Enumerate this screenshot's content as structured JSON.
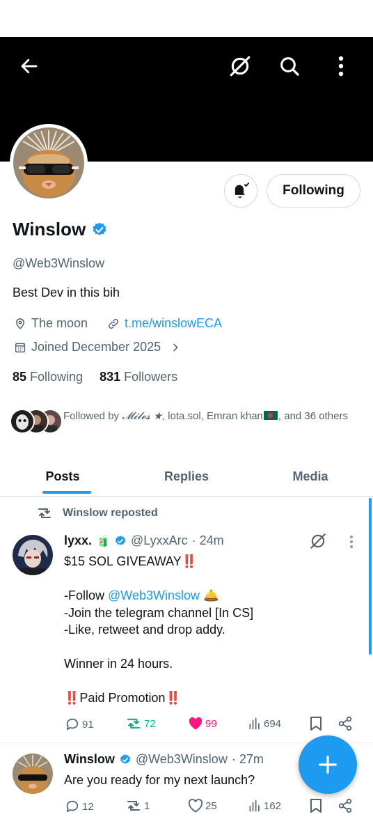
{
  "profile": {
    "name": "Winslow",
    "handle": "@Web3Winslow",
    "bio": "Best Dev in this bih",
    "location": "The moon",
    "website": "t.me/winslowECA",
    "joined": "Joined December 2025",
    "following_count": "85",
    "following_label": "Following",
    "followers_count": "831",
    "followers_label": "Followers",
    "follow_button": "Following",
    "followed_by_prefix": "Followed by ",
    "followed_by_1": "𝓜𝓲𝓵𝓮𝓼 ★",
    "followed_by_rest": ", lota.sol, Emran khan",
    "followed_by_suffix": ", and 36 others"
  },
  "header": {
    "icons": [
      "back-arrow-icon",
      "grok-icon",
      "search-icon",
      "more-vert-icon"
    ]
  },
  "tabs": [
    "Posts",
    "Replies",
    "Media"
  ],
  "colors": {
    "accent": "#1d9bf0",
    "banner": "#000000",
    "like": "#f91880",
    "repost": "#00ba7c"
  },
  "posts": [
    {
      "repost_label": "Winslow reposted",
      "author": "lyxx.",
      "emoji": "🧃",
      "handle": "@LyxxArc",
      "time": "· 24m",
      "lines": {
        "l1": "$15 SOL GIVEAWAY",
        "l1_emoji": "‼️",
        "l2_prefix": "-Follow ",
        "l2_mention": "@Web3Winslow",
        "l2_emoji": "🛎️",
        "l3": "-Join the telegram channel [In CS]",
        "l4": "-Like, retweet and drop addy.",
        "l5": "Winner in 24 hours.",
        "l6_emoji_a": "‼️",
        "l6": "Paid Promotion",
        "l6_emoji_b": "‼️"
      },
      "replies": "91",
      "reposts": "72",
      "likes": "99",
      "views": "694",
      "liked": true,
      "reposted": true
    },
    {
      "author": "Winslow",
      "handle": "@Web3Winslow",
      "time": "· 27m",
      "text": "Are you ready for my next launch?",
      "replies": "12",
      "reposts": "1",
      "likes": "25",
      "views": "162"
    }
  ]
}
